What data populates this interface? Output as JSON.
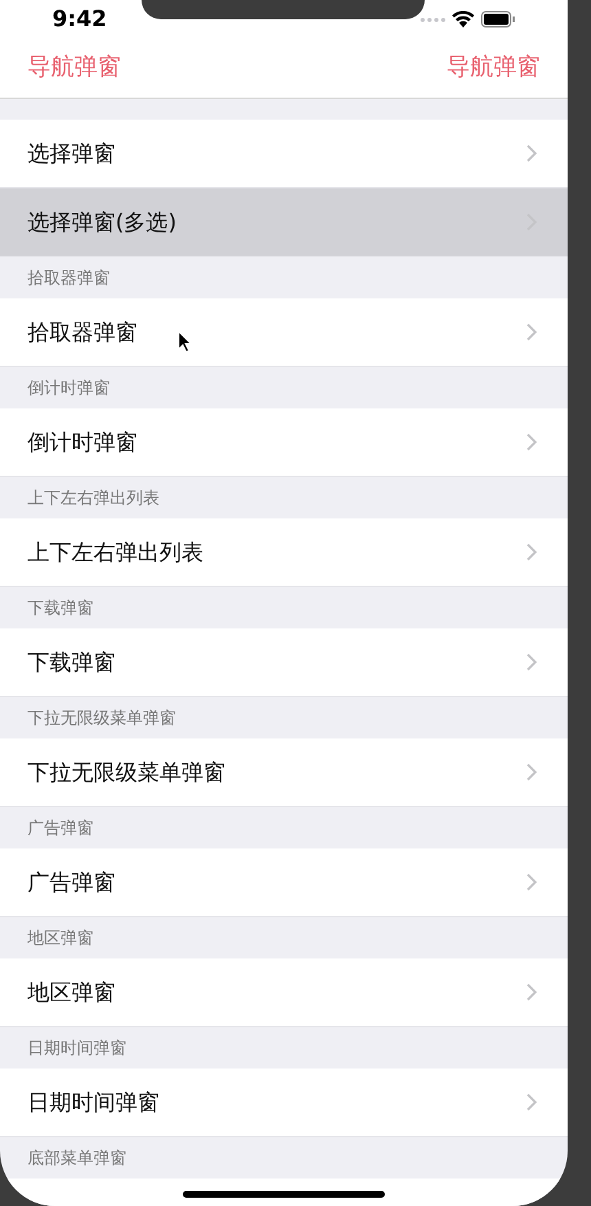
{
  "status_bar": {
    "time": "9:42"
  },
  "nav_bar": {
    "left": "导航弹窗",
    "right": "导航弹窗"
  },
  "sections": [
    {
      "rows": [
        {
          "label": "选择弹窗",
          "selected": false
        },
        {
          "label": "选择弹窗(多选)",
          "selected": true
        }
      ]
    },
    {
      "header": "拾取器弹窗",
      "rows": [
        {
          "label": "拾取器弹窗",
          "selected": false
        }
      ]
    },
    {
      "header": "倒计时弹窗",
      "rows": [
        {
          "label": "倒计时弹窗",
          "selected": false
        }
      ]
    },
    {
      "header": "上下左右弹出列表",
      "rows": [
        {
          "label": "上下左右弹出列表",
          "selected": false
        }
      ]
    },
    {
      "header": "下载弹窗",
      "rows": [
        {
          "label": "下载弹窗",
          "selected": false
        }
      ]
    },
    {
      "header": "下拉无限级菜单弹窗",
      "rows": [
        {
          "label": "下拉无限级菜单弹窗",
          "selected": false
        }
      ]
    },
    {
      "header": "广告弹窗",
      "rows": [
        {
          "label": "广告弹窗",
          "selected": false
        }
      ]
    },
    {
      "header": "地区弹窗",
      "rows": [
        {
          "label": "地区弹窗",
          "selected": false
        }
      ]
    },
    {
      "header": "日期时间弹窗",
      "rows": [
        {
          "label": "日期时间弹窗",
          "selected": false
        }
      ]
    },
    {
      "header": "底部菜单弹窗"
    }
  ]
}
